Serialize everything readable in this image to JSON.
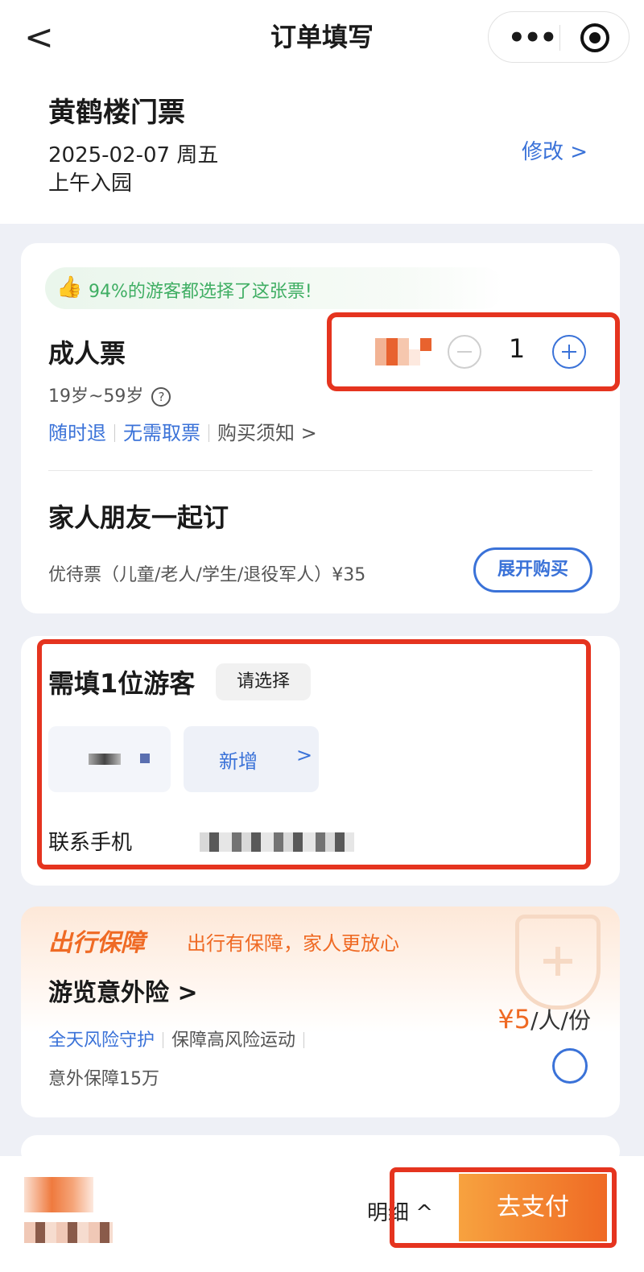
{
  "nav": {
    "back_glyph": "<",
    "title": "订单填写",
    "menu_glyph": "•••"
  },
  "order": {
    "title": "黄鹤楼门票",
    "date": "2025-02-07 周五",
    "entry": "上午入园",
    "edit_label": "修改 >"
  },
  "ticket": {
    "tip": "94%的游客都选择了这张票!",
    "name": "成人票",
    "age_range": "19岁~59岁",
    "help_glyph": "?",
    "tags": [
      "随时退",
      "无需取票",
      "购买须知 >"
    ],
    "quantity": "1"
  },
  "family": {
    "title": "家人朋友一起订",
    "desc": "优待票（儿童/老人/学生/退役军人）¥35",
    "expand_label": "展开购买"
  },
  "guest": {
    "title": "需填1位游客",
    "choose_label": "请选择",
    "add_label": "新增",
    "add_chevron": ">",
    "phone_label": "联系手机"
  },
  "insurance": {
    "brand": "出行保障",
    "slogan": "出行有保障，家人更放心",
    "title": "游览意外险 >",
    "tags": [
      "全天风险守护",
      "保障高风险运动"
    ],
    "coverage": "意外保障15万",
    "price_num": "¥5",
    "price_unit": "/人/份"
  },
  "bottom": {
    "detail_label": "明细 ^",
    "pay_label": "去支付"
  },
  "colors": {
    "accent_blue": "#3a72d8",
    "accent_orange": "#ef6a24",
    "tip_green": "#3fae63",
    "highlight_red": "#e5341f"
  }
}
